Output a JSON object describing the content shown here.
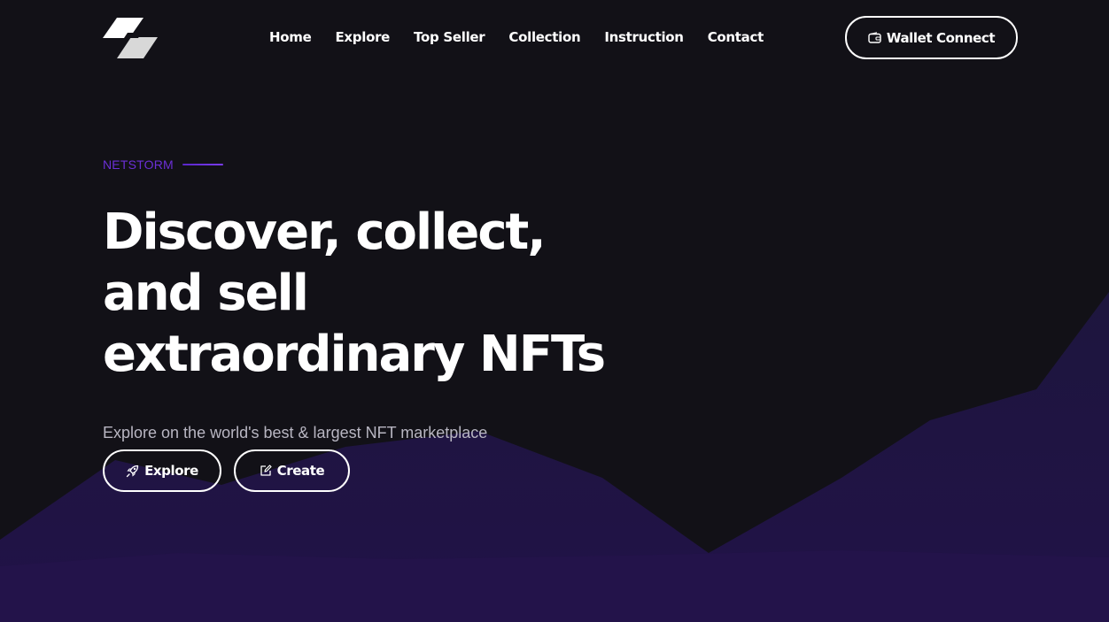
{
  "nav": {
    "links": [
      "Home",
      "Explore",
      "Top Seller",
      "Collection",
      "Instruction",
      "Contact"
    ],
    "wallet_button": "Wallet Connect",
    "wallet_icon": "wallet-icon"
  },
  "hero": {
    "eyebrow": "NETSTORM",
    "headline": [
      "Discover, collect,",
      "and sell",
      "extraordinary NFTs"
    ],
    "subtitle": "Explore on the world's best & largest NFT marketplace",
    "buttons": [
      {
        "label": "Explore",
        "icon": "rocket-icon"
      },
      {
        "label": "Create",
        "icon": "edit-icon"
      }
    ]
  },
  "colors": {
    "background": "#121117",
    "accent": "#6b2fd6",
    "wave": "#1d1538",
    "text": "#ffffff",
    "muted_text": "#b8b6c2"
  }
}
